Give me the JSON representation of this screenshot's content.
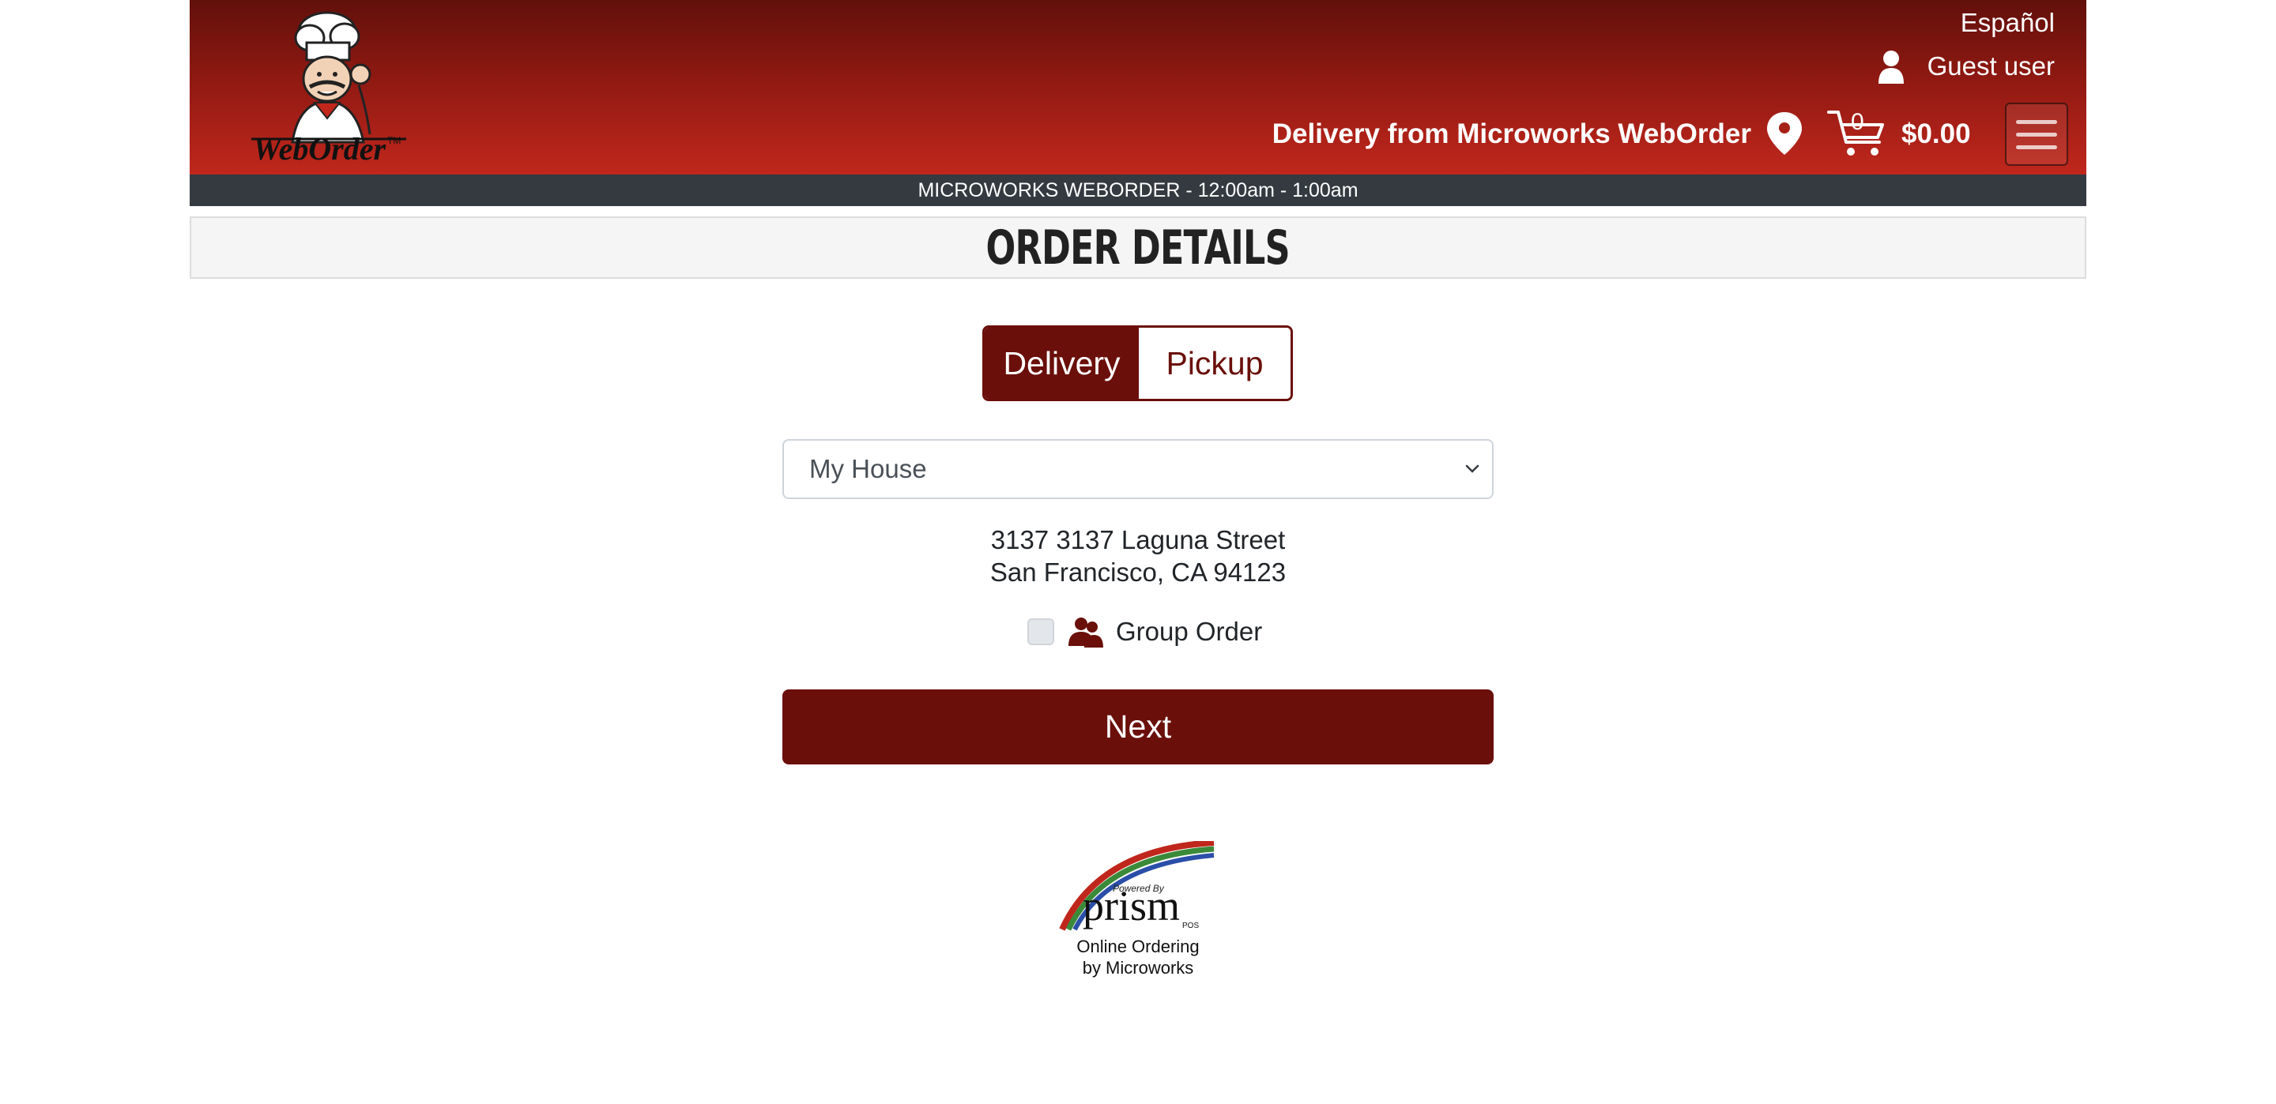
{
  "header": {
    "brand": "WebOrder",
    "brand_tm": "TM",
    "language_link": "Español",
    "user_label": "Guest user",
    "delivery_text": "Delivery from Microworks WebOrder",
    "cart_count": "0",
    "cart_total": "$0.00"
  },
  "hours_bar": "MICROWORKS WEBORDER - 12:00am - 1:00am",
  "page_title": "Order Details",
  "order_type": {
    "options": [
      "Delivery",
      "Pickup"
    ],
    "selected": "Delivery"
  },
  "address_select": {
    "selected": "My House"
  },
  "address": {
    "line1": "3137 3137 Laguna Street",
    "line2": "San Francisco, CA 94123"
  },
  "group_order": {
    "label": "Group Order",
    "checked": false
  },
  "next_button": "Next",
  "footer": {
    "logo_small": "Powered By",
    "logo_main": "prism",
    "logo_suffix": "POS",
    "line1": "Online Ordering",
    "line2": "by Microworks"
  },
  "colors": {
    "brand_red_dark": "#6a0f0a",
    "header_gradient_top": "#62100b",
    "header_gradient_bottom": "#c0271c",
    "hours_bar": "#343a40"
  }
}
